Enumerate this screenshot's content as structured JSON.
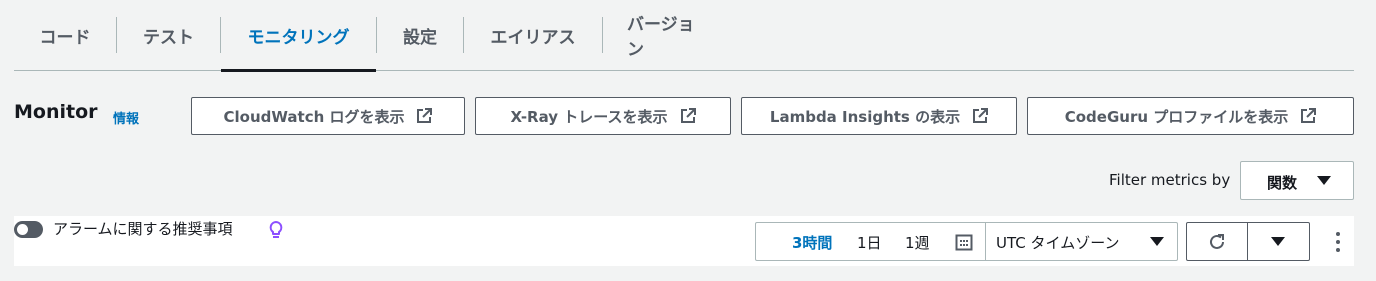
{
  "tabs": [
    {
      "label": "コード",
      "active": false
    },
    {
      "label": "テスト",
      "active": false
    },
    {
      "label": "モニタリング",
      "active": true
    },
    {
      "label": "設定",
      "active": false
    },
    {
      "label": "エイリアス",
      "active": false
    },
    {
      "label": "バージョン",
      "active": false
    }
  ],
  "monitor": {
    "title": "Monitor",
    "info_link": "情報"
  },
  "external_buttons": {
    "cloudwatch": "CloudWatch ログを表示",
    "xray": "X-Ray トレースを表示",
    "lambda_insights": "Lambda Insights の表示",
    "codeguru": "CodeGuru プロファイルを表示"
  },
  "filter": {
    "label": "Filter metrics by",
    "selected": "関数"
  },
  "alarm": {
    "label": "アラームに関する推奨事項",
    "toggle_on": false
  },
  "time_range": {
    "options": [
      "3時間",
      "1日",
      "1週"
    ],
    "selected": "3時間",
    "timezone": "UTC タイムゾーン"
  },
  "colors": {
    "accent": "#0073bb",
    "text": "#16191f",
    "muted": "#545b64",
    "border": "#aab7b8",
    "background": "#f2f3f3",
    "bulb": "#8c4fff"
  },
  "icons": [
    "external-link-icon",
    "lightbulb-icon",
    "calendar-icon",
    "refresh-icon",
    "caret-down-icon",
    "kebab-menu-icon"
  ]
}
